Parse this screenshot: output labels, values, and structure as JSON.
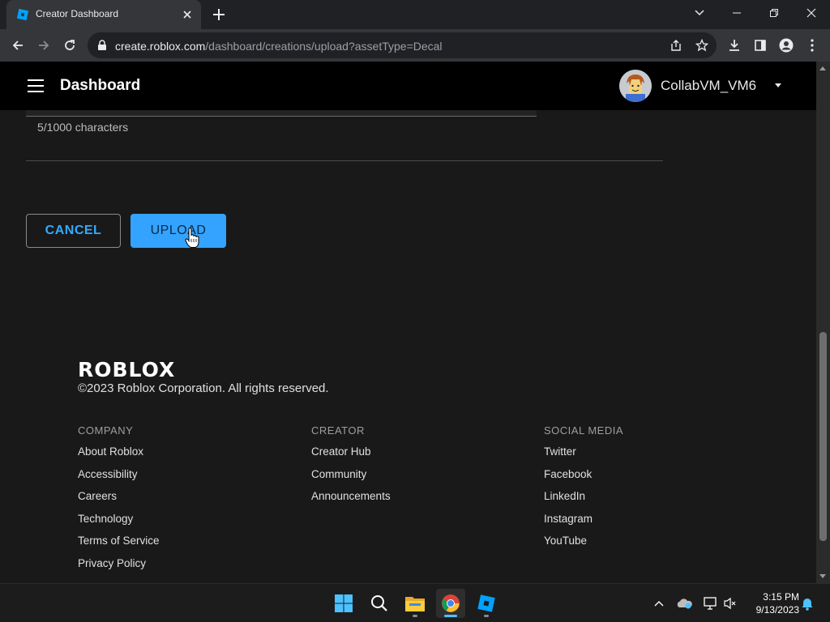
{
  "browser": {
    "tab_title": "Creator Dashboard",
    "url_host": "create.roblox.com",
    "url_path": "/dashboard/creations/upload?assetType=Decal"
  },
  "header": {
    "title": "Dashboard",
    "username": "CollabVM_VM6"
  },
  "form": {
    "char_count": "5/1000 characters",
    "cancel_label": "CANCEL",
    "upload_label": "UPLOAD"
  },
  "footer": {
    "logo_text": "ROBLOX",
    "copyright": "©2023 Roblox Corporation. All rights reserved.",
    "columns": [
      {
        "heading": "COMPANY",
        "links": [
          "About Roblox",
          "Accessibility",
          "Careers",
          "Technology",
          "Terms of Service",
          "Privacy Policy"
        ]
      },
      {
        "heading": "CREATOR",
        "links": [
          "Creator Hub",
          "Community",
          "Announcements"
        ]
      },
      {
        "heading": "SOCIAL MEDIA",
        "links": [
          "Twitter",
          "Facebook",
          "LinkedIn",
          "Instagram",
          "YouTube"
        ]
      }
    ]
  },
  "taskbar": {
    "time": "3:15 PM",
    "date": "9/13/2023"
  },
  "colors": {
    "accent": "#33a3ff",
    "header_bg": "#000000",
    "page_bg": "#191919"
  }
}
